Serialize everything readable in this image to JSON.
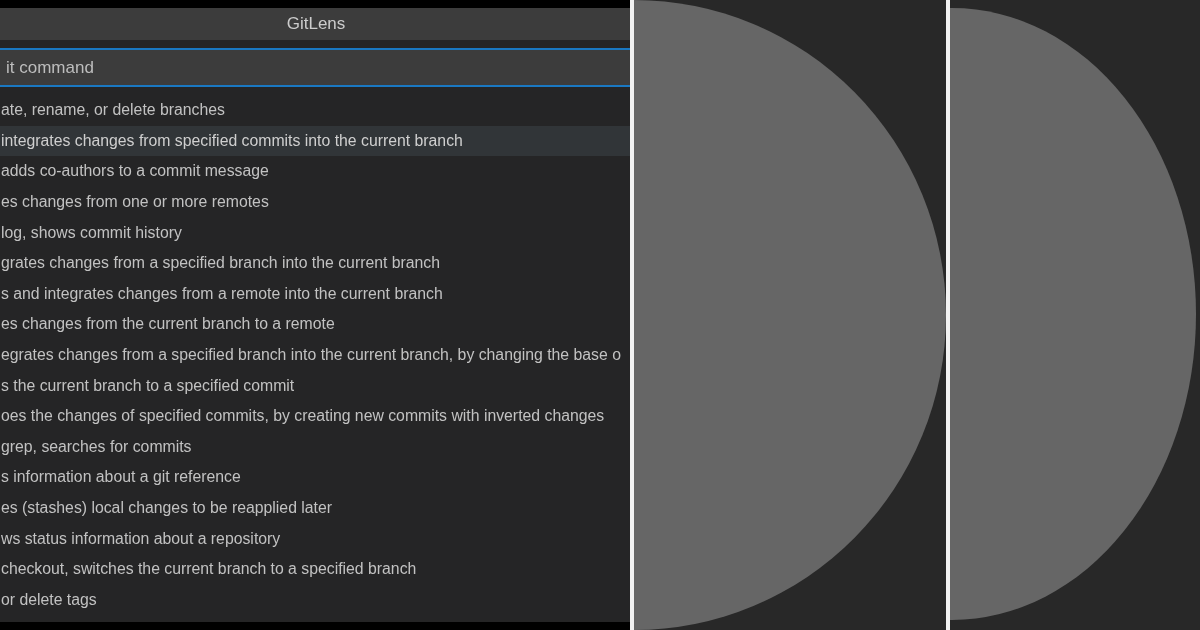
{
  "window": {
    "title": "GitLens"
  },
  "search": {
    "placeholder": "it command"
  },
  "items": [
    {
      "text": "ate, rename, or delete branches",
      "selected": false
    },
    {
      "text": "integrates changes from specified commits into the current branch",
      "selected": true
    },
    {
      "text": "adds co-authors to a commit message",
      "selected": false
    },
    {
      "text": "es changes from one or more remotes",
      "selected": false
    },
    {
      "text": "log, shows commit history",
      "selected": false
    },
    {
      "text": "grates changes from a specified branch into the current branch",
      "selected": false
    },
    {
      "text": "s and integrates changes from a remote into the current branch",
      "selected": false
    },
    {
      "text": "es changes from the current branch to a remote",
      "selected": false
    },
    {
      "text": "egrates changes from a specified branch into the current branch, by changing the base o",
      "selected": false
    },
    {
      "text": "s the current branch to a specified commit",
      "selected": false
    },
    {
      "text": "oes the changes of specified commits, by creating new commits with inverted changes",
      "selected": false
    },
    {
      "text": "grep, searches for commits",
      "selected": false
    },
    {
      "text": "s information about a git reference",
      "selected": false
    },
    {
      "text": "es (stashes) local changes to be reapplied later",
      "selected": false
    },
    {
      "text": "ws status information about a repository",
      "selected": false
    },
    {
      "text": "checkout, switches the current branch to a specified branch",
      "selected": false
    },
    {
      "text": "or delete tags",
      "selected": false
    }
  ]
}
